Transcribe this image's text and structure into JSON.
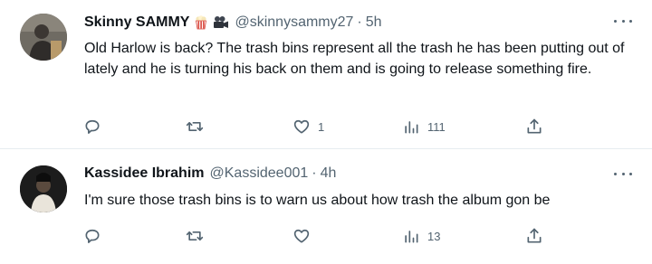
{
  "tweets": [
    {
      "display_name": "Skinny SAMMY",
      "badges": [
        "popcorn-emoji",
        "movie-camera-emoji"
      ],
      "handle": "@skinnysammy27",
      "separator": "·",
      "time": "5h",
      "text": "Old Harlow is back? The trash bins represent all the trash he has been putting out of lately and he is turning his back on them and is going to release something fire.",
      "actions": {
        "reply": {
          "icon": "reply-icon",
          "count": ""
        },
        "retweet": {
          "icon": "retweet-icon",
          "count": ""
        },
        "like": {
          "icon": "heart-icon",
          "count": "1"
        },
        "views": {
          "icon": "views-icon",
          "count": "111"
        },
        "share": {
          "icon": "share-icon",
          "count": ""
        }
      }
    },
    {
      "display_name": "Kassidee Ibrahim",
      "badges": [],
      "handle": "@Kassidee001",
      "separator": "·",
      "time": "4h",
      "text": "I'm sure those trash bins is to warn us about how trash the album gon be",
      "actions": {
        "reply": {
          "icon": "reply-icon",
          "count": ""
        },
        "retweet": {
          "icon": "retweet-icon",
          "count": ""
        },
        "like": {
          "icon": "heart-icon",
          "count": ""
        },
        "views": {
          "icon": "views-icon",
          "count": "13"
        },
        "share": {
          "icon": "share-icon",
          "count": ""
        }
      }
    }
  ],
  "colors": {
    "text": "#0f1419",
    "secondary": "#536471",
    "divider": "#e6ecf0",
    "background": "#ffffff"
  }
}
